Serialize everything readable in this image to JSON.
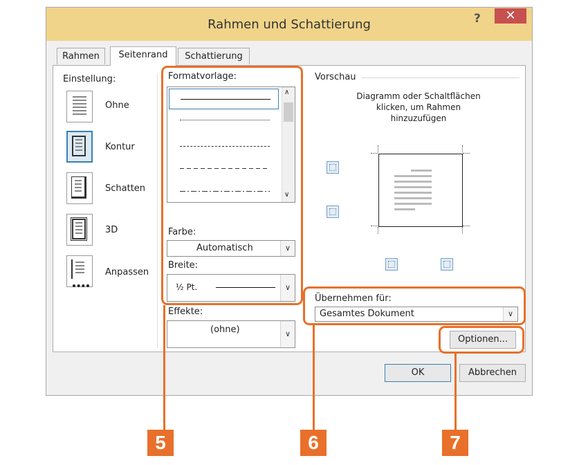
{
  "window": {
    "title": "Rahmen und Schattierung",
    "help": "?",
    "close": "✕"
  },
  "tabs": [
    {
      "label": "Rahmen",
      "active": false
    },
    {
      "label": "Seitenrand",
      "active": true
    },
    {
      "label": "Schattierung",
      "active": false
    }
  ],
  "einstellung": {
    "heading": "Einstellung:",
    "items": [
      {
        "label": "Ohne",
        "icon": "none-border-icon"
      },
      {
        "label": "Kontur",
        "icon": "box-border-icon",
        "selected": true
      },
      {
        "label": "Schatten",
        "icon": "shadow-border-icon"
      },
      {
        "label": "3D",
        "icon": "3d-border-icon"
      },
      {
        "label": "Anpassen",
        "icon": "custom-border-icon"
      }
    ]
  },
  "format": {
    "heading": "Formatvorlage:",
    "styles": [
      "solid",
      "dotted",
      "dashed-small",
      "dashed",
      "dash-dot"
    ]
  },
  "farbe": {
    "label": "Farbe:",
    "value": "Automatisch"
  },
  "breite": {
    "label": "Breite:",
    "value": "½ Pt."
  },
  "effekte": {
    "label": "Effekte:",
    "value": "(ohne)"
  },
  "vorschau": {
    "heading": "Vorschau",
    "hint": [
      "Diagramm oder Schaltflächen",
      "klicken, um Rahmen",
      "hinzuzufügen"
    ]
  },
  "uebernehmen": {
    "label": "Übernehmen für:",
    "value": "Gesamtes Dokument"
  },
  "buttons": {
    "optionen": "Optionen...",
    "ok": "OK",
    "abbrechen": "Abbrechen"
  },
  "callouts": [
    "5",
    "6",
    "7"
  ],
  "colors": {
    "accent": "#e8702a",
    "titlebar": "#f0d48a",
    "close": "#c75050",
    "selection": "#3c7fb1"
  }
}
